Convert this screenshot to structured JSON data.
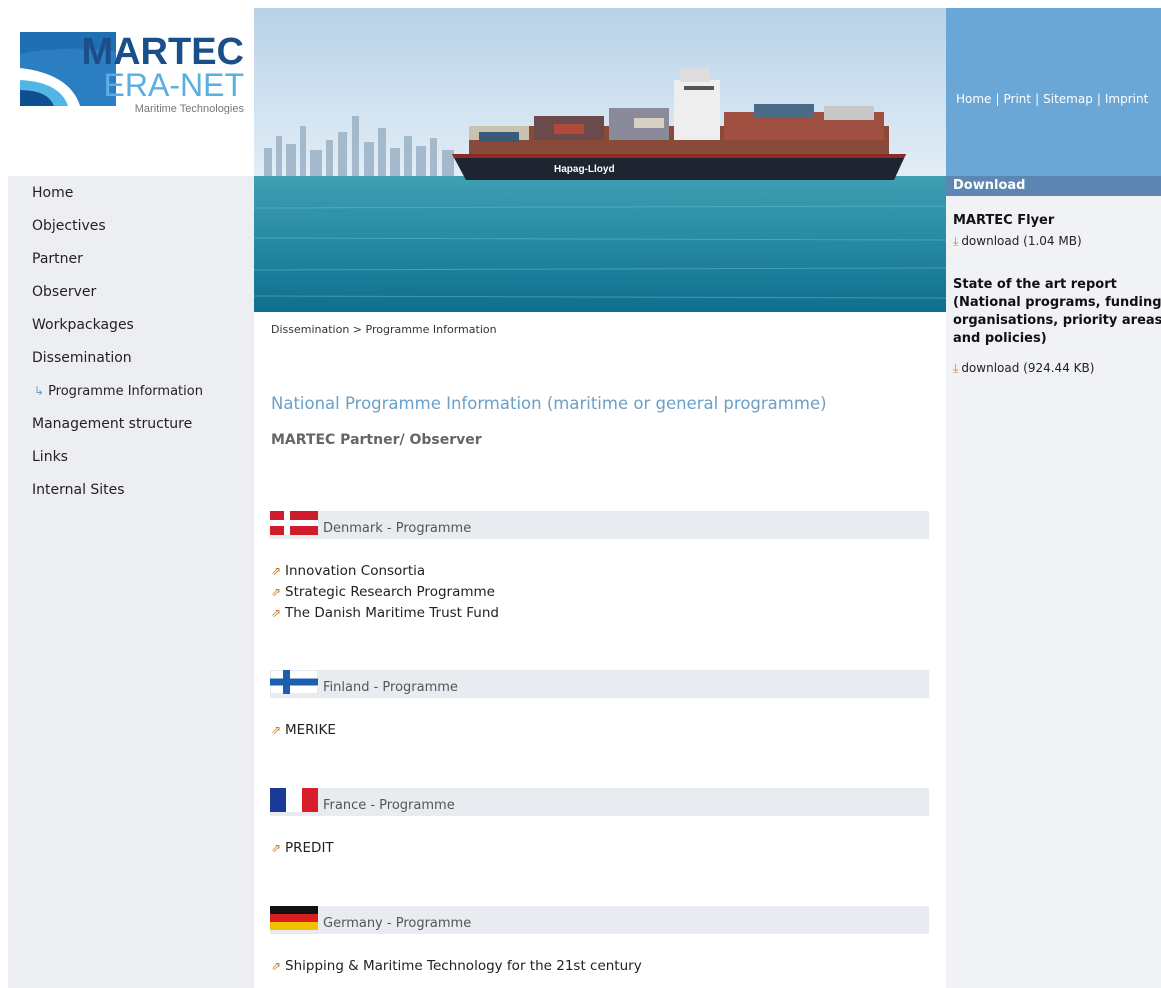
{
  "logo": {
    "name": "MARTEC",
    "subname": "ERA-NET",
    "tagline": "Maritime Technologies"
  },
  "hero": {
    "ship_name": "Hapag-Lloyd"
  },
  "toplinks": [
    {
      "label": "Home"
    },
    {
      "label": "Print"
    },
    {
      "label": "Sitemap"
    },
    {
      "label": "Imprint"
    }
  ],
  "nav": {
    "items": [
      {
        "label": "Home"
      },
      {
        "label": "Objectives"
      },
      {
        "label": "Partner"
      },
      {
        "label": "Observer"
      },
      {
        "label": "Workpackages"
      },
      {
        "label": "Dissemination"
      },
      {
        "label": "Programme Information"
      },
      {
        "label": "Management structure"
      },
      {
        "label": "Links"
      },
      {
        "label": "Internal Sites"
      }
    ]
  },
  "breadcrumb": "Dissemination > Programme Information",
  "main": {
    "title": "National Programme Information (maritime or general programme)",
    "subtitle": "MARTEC Partner/ Observer",
    "countries": [
      {
        "name": "Denmark - Programme",
        "programmes": [
          "Innovation Consortia",
          "Strategic Research Programme",
          "The Danish Maritime Trust Fund"
        ]
      },
      {
        "name": "Finland - Programme",
        "programmes": [
          "MERIKE"
        ]
      },
      {
        "name": "France - Programme",
        "programmes": [
          "PREDIT"
        ]
      },
      {
        "name": "Germany - Programme",
        "programmes": [
          "Shipping & Maritime Technology for the 21st century"
        ]
      }
    ]
  },
  "downloads": {
    "header": "Download",
    "items": [
      {
        "title": "MARTEC Flyer",
        "link": "download (1.04 MB)"
      },
      {
        "title_lines": [
          "State of the art report",
          "(National programs, funding",
          "organisations, priority areas",
          "and policies)"
        ],
        "link": "download (924.44 KB)"
      }
    ]
  },
  "colors": {
    "accent_blue": "#6aa6d6",
    "download_header": "#5d87b2",
    "title_blue": "#6aa0c8",
    "nav_bg": "#eceef2"
  }
}
